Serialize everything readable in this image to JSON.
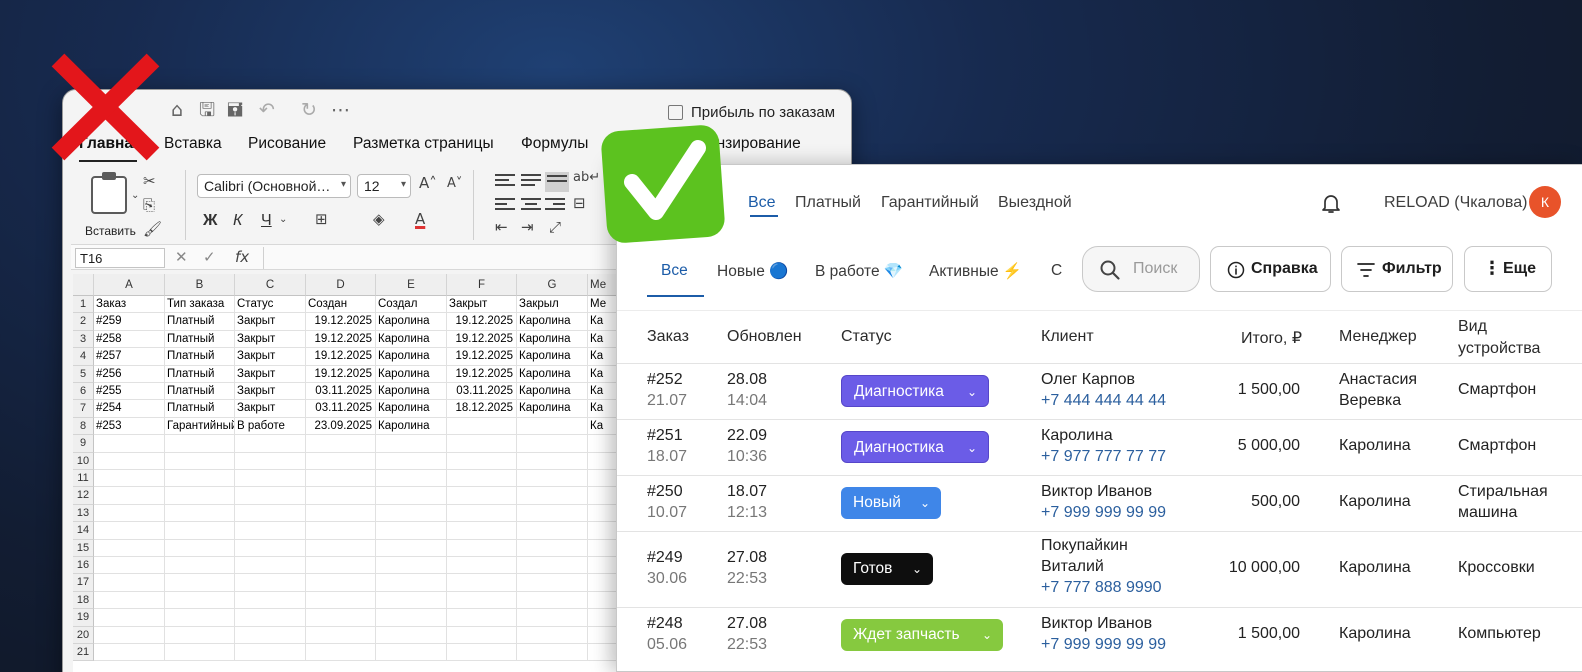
{
  "excel": {
    "doc_title": "Прибыль по заказам",
    "menu": [
      "Главная",
      "Вставка",
      "Рисование",
      "Разметка страницы",
      "Формулы",
      "Рецензирование"
    ],
    "paste_label": "Вставить",
    "font_name": "Calibri (Основной…",
    "font_size": "12",
    "bold_label": "Ж",
    "italic_label": "К",
    "underline_label": "Ч",
    "fx_label": "fx",
    "name_box": "T16",
    "columns": [
      "A",
      "B",
      "C",
      "D",
      "E",
      "F",
      "G"
    ],
    "partial_header": "Ме",
    "rows": [
      [
        "1",
        "Заказ",
        "Тип заказа",
        "Статус",
        "Создан",
        "Создал",
        "Закрыт",
        "Закрыл"
      ],
      [
        "2",
        "#259",
        "Платный",
        "Закрыт",
        "19.12.2025",
        "Каролина",
        "19.12.2025",
        "Каролина"
      ],
      [
        "3",
        "#258",
        "Платный",
        "Закрыт",
        "19.12.2025",
        "Каролина",
        "19.12.2025",
        "Каролина"
      ],
      [
        "4",
        "#257",
        "Платный",
        "Закрыт",
        "19.12.2025",
        "Каролина",
        "19.12.2025",
        "Каролина"
      ],
      [
        "5",
        "#256",
        "Платный",
        "Закрыт",
        "19.12.2025",
        "Каролина",
        "19.12.2025",
        "Каролина"
      ],
      [
        "6",
        "#255",
        "Платный",
        "Закрыт",
        "03.11.2025",
        "Каролина",
        "03.11.2025",
        "Каролина"
      ],
      [
        "7",
        "#254",
        "Платный",
        "Закрыт",
        "03.11.2025",
        "Каролина",
        "18.12.2025",
        "Каролина"
      ],
      [
        "8",
        "#253",
        "Гарантийный",
        "В работе",
        "23.09.2025",
        "Каролина",
        "",
        ""
      ]
    ],
    "extra_row_numbers": [
      "9",
      "10",
      "11",
      "12",
      "13",
      "14",
      "15",
      "16",
      "17",
      "18",
      "19",
      "20",
      "21"
    ],
    "partial_col_values": [
      "Ка",
      "Ка",
      "Ка",
      "Ка",
      "Ка",
      "Ка",
      "Ка"
    ]
  },
  "crm": {
    "tabs_top": [
      "Все",
      "Платный",
      "Гарантийный",
      "Выездной"
    ],
    "user": "RELOAD (Чкалова)",
    "avatar_letter": "К",
    "tabs_status": [
      "Все",
      "Новые 🔵",
      "В работе 💎",
      "Активные ⚡",
      "С"
    ],
    "search_placeholder": "Поиск",
    "btn_help": "Справка",
    "btn_filter": "Фильтр",
    "btn_more": "Еще",
    "headers": {
      "order": "Заказ",
      "updated": "Обновлен",
      "status": "Статус",
      "client": "Клиент",
      "total": "Итого, ₽",
      "manager": "Менеджер",
      "device_1": "Вид",
      "device_2": "устройства"
    },
    "orders": [
      {
        "id": "#252",
        "date": "21.07",
        "upd_date": "28.08",
        "upd_time": "14:04",
        "status": "Диагностика",
        "status_color": "#6b5ce7",
        "client": "Олег Карпов",
        "client2": "",
        "phone": "+7 444 444 44 44",
        "total": "1 500,00",
        "manager": "Анастасия",
        "manager2": "Веревка",
        "device": "Смартфон",
        "device2": ""
      },
      {
        "id": "#251",
        "date": "18.07",
        "upd_date": "22.09",
        "upd_time": "10:36",
        "status": "Диагностика",
        "status_color": "#6b5ce7",
        "client": "Каролина",
        "client2": "",
        "phone": "+7 977 777 77 77",
        "total": "5 000,00",
        "manager": "Каролина",
        "manager2": "",
        "device": "Смартфон",
        "device2": ""
      },
      {
        "id": "#250",
        "date": "10.07",
        "upd_date": "18.07",
        "upd_time": "12:13",
        "status": "Новый",
        "status_color": "#3f86e8",
        "client": "Виктор Иванов",
        "client2": "",
        "phone": "+7 999 999 99 99",
        "total": "500,00",
        "manager": "Каролина",
        "manager2": "",
        "device": "Стиральная",
        "device2": "машина"
      },
      {
        "id": "#249",
        "date": "30.06",
        "upd_date": "27.08",
        "upd_time": "22:53",
        "status": "Готов",
        "status_color": "#0e0e0e",
        "client": "Покупайкин",
        "client2": "Виталий",
        "phone": "+7 777 888 9990",
        "total": "10 000,00",
        "manager": "Каролина",
        "manager2": "",
        "device": "Кроссовки",
        "device2": ""
      },
      {
        "id": "#248",
        "date": "05.06",
        "upd_date": "27.08",
        "upd_time": "22:53",
        "status": "Ждет запчасть",
        "status_color": "#7cc43a",
        "client": "Виктор Иванов",
        "client2": "",
        "phone": "+7 999 999 99 99",
        "total": "1 500,00",
        "manager": "Каролина",
        "manager2": "",
        "device": "Компьютер",
        "device2": ""
      }
    ]
  },
  "marks": {
    "cross_color": "#e3161b",
    "check_bg": "#5cc21f",
    "check_mark": "#ffffff"
  }
}
